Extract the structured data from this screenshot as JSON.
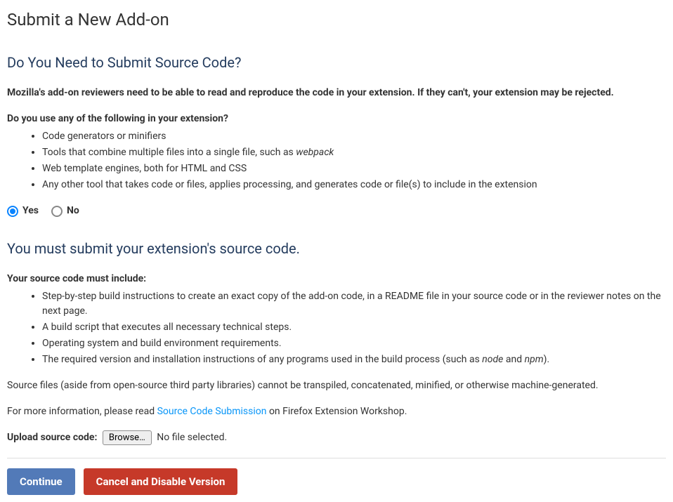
{
  "page": {
    "title": "Submit a New Add-on"
  },
  "section1": {
    "heading": "Do You Need to Submit Source Code?",
    "intro": "Mozilla's add-on reviewers need to be able to read and reproduce the code in your extension. If they can't, your extension may be rejected.",
    "question": "Do you use any of the following in your extension?",
    "bullets": {
      "b0_pre": "Code generators or minifiers",
      "b1_pre": "Tools that combine multiple files into a single file, such as ",
      "b1_em": "webpack",
      "b2_pre": "Web template engines, both for HTML and CSS",
      "b3_pre": "Any other tool that takes code or files, applies processing, and generates code or file(s) to include in the extension"
    }
  },
  "radios": {
    "yes": "Yes",
    "no": "No",
    "selected": "yes"
  },
  "section2": {
    "heading": "You must submit your extension's source code.",
    "intro": "Your source code must include:",
    "bullets": {
      "b0": "Step-by-step build instructions to create an exact copy of the add-on code, in a README file in your source code or in the reviewer notes on the next page.",
      "b1": "A build script that executes all necessary technical steps.",
      "b2": "Operating system and build environment requirements.",
      "b3_pre": "The required version and installation instructions of any programs used in the build process (such as ",
      "b3_em1": "node",
      "b3_mid": " and ",
      "b3_em2": "npm",
      "b3_post": ")."
    },
    "note": "Source files (aside from open-source third party libraries) cannot be transpiled, concatenated, minified, or otherwise machine-generated.",
    "moreinfo_pre": "For more information, please read ",
    "moreinfo_link": "Source Code Submission",
    "moreinfo_post": " on Firefox Extension Workshop."
  },
  "upload": {
    "label": "Upload source code:",
    "browse": "Browse…",
    "nofile": "No file selected."
  },
  "buttons": {
    "continue": "Continue",
    "cancel": "Cancel and Disable Version"
  }
}
